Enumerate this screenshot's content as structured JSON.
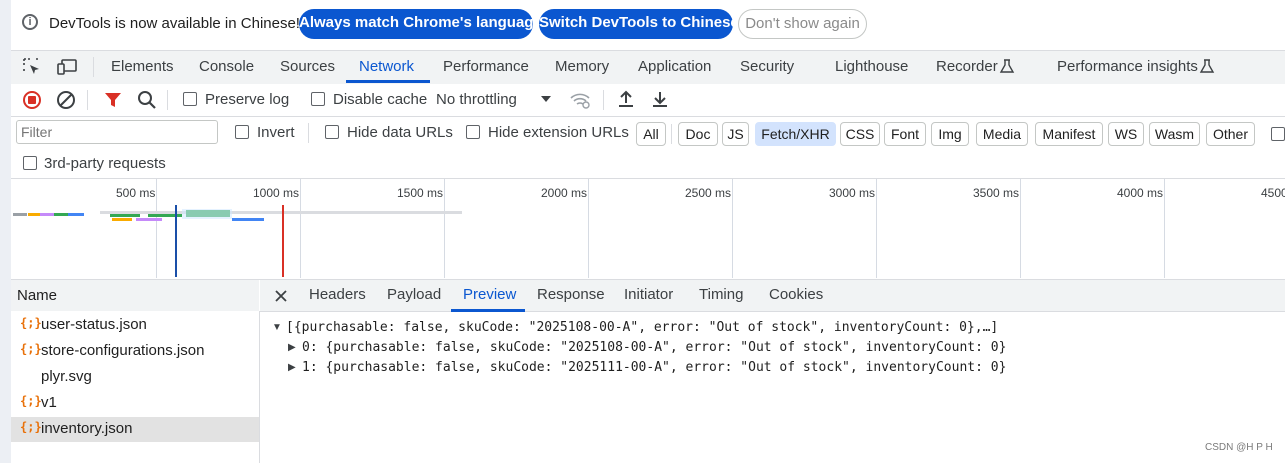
{
  "infobar": {
    "message": "DevTools is now available in Chinese!",
    "match_button": "Always match Chrome's language",
    "switch_button": "Switch DevTools to Chinese",
    "dismiss_button": "Don't show again"
  },
  "tabs": [
    "Elements",
    "Console",
    "Sources",
    "Network",
    "Performance",
    "Memory",
    "Application",
    "Security",
    "Lighthouse",
    "Recorder",
    "Performance insights"
  ],
  "active_tab": "Network",
  "toolbar": {
    "preserve_log": "Preserve log",
    "disable_cache": "Disable cache",
    "throttling": "No throttling"
  },
  "filter_bar": {
    "placeholder": "Filter",
    "invert": "Invert",
    "hide_data_urls": "Hide data URLs",
    "hide_extension_urls": "Hide extension URLs",
    "type_filters": [
      "All",
      "Doc",
      "JS",
      "Fetch/XHR",
      "CSS",
      "Font",
      "Img",
      "Media",
      "Manifest",
      "WS",
      "Wasm",
      "Other"
    ],
    "selected_filter": "Fetch/XHR",
    "third_party": "3rd-party requests"
  },
  "timeline": {
    "ticks": [
      "500 ms",
      "1000 ms",
      "1500 ms",
      "2000 ms",
      "2500 ms",
      "3000 ms",
      "3500 ms",
      "4000 ms",
      "4500"
    ]
  },
  "requests": {
    "header": "Name",
    "items": [
      {
        "name": "user-status.json",
        "icon": "{;}"
      },
      {
        "name": "store-configurations.json",
        "icon": "{;}"
      },
      {
        "name": "plyr.svg",
        "icon": ""
      },
      {
        "name": "v1",
        "icon": "{;}"
      },
      {
        "name": "inventory.json",
        "icon": "{;}"
      }
    ],
    "selected": "inventory.json"
  },
  "detail": {
    "tabs": [
      "Headers",
      "Payload",
      "Preview",
      "Response",
      "Initiator",
      "Timing",
      "Cookies"
    ],
    "active": "Preview",
    "preview_lines": [
      "[{purchasable: false, skuCode: \"2025108-00-A\", error: \"Out of stock\", inventoryCount: 0},…]",
      "0: {purchasable: false, skuCode: \"2025108-00-A\", error: \"Out of stock\", inventoryCount: 0}",
      "1: {purchasable: false, skuCode: \"2025111-00-A\", error: \"Out of stock\", inventoryCount: 0}"
    ]
  },
  "watermark": "CSDN @H P H",
  "colors": {
    "accent": "#0b57d0",
    "record": "#d93025",
    "json_icon": "#e8710a"
  }
}
